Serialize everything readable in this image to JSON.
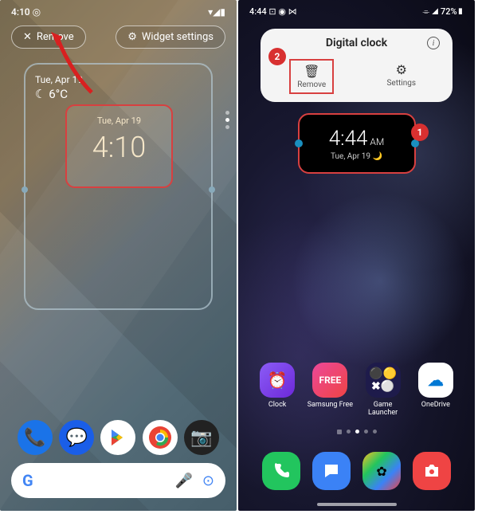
{
  "left": {
    "status": {
      "time": "4:10",
      "icons": "◎",
      "right_icons": "▾◢▮"
    },
    "actions": {
      "remove": "Remove",
      "settings": "Widget settings"
    },
    "weather": {
      "date": "Tue, Apr 19",
      "temp": "6°C",
      "icon": "☾"
    },
    "clock": {
      "date": "Tue, Apr 19",
      "time": "4:10"
    },
    "dock": [
      "phone",
      "messages",
      "play",
      "chrome",
      "camera"
    ]
  },
  "right": {
    "status": {
      "time": "4:44",
      "left_icons": "⊡ ◉ ⋈",
      "right_icons": "⌯ ◢ 72%▮"
    },
    "popup": {
      "title": "Digital clock",
      "remove": "Remove",
      "settings": "Settings"
    },
    "badges": {
      "b1": "1",
      "b2": "2"
    },
    "widget": {
      "time": "4:44",
      "ampm": "AM",
      "date": "Tue, Apr 19",
      "moon": "🌙"
    },
    "apps": [
      {
        "label": "Clock"
      },
      {
        "label": "Samsung Free",
        "text": "FREE"
      },
      {
        "label": "Game Launcher"
      },
      {
        "label": "OneDrive"
      }
    ]
  }
}
